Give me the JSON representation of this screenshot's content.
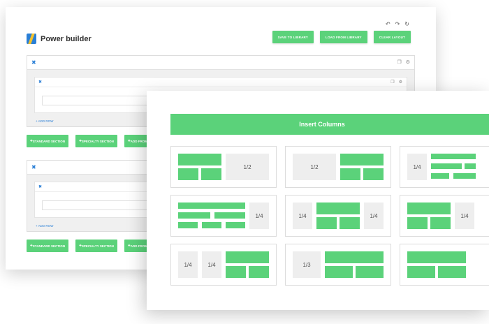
{
  "builder": {
    "brand": "Power builder",
    "undo_icons": [
      "undo-icon",
      "redo-icon",
      "reset-icon"
    ],
    "top_buttons": [
      "SAVE TO LIBRARY",
      "LOAD FROM LIBRARY",
      "CLEAR LAYOUT"
    ],
    "sections": [
      {
        "add_row": "ADD ROW",
        "buttons": [
          "STANDARD SECTION",
          "SPECIALTY SECTION",
          "ADD FROM LI"
        ]
      },
      {
        "add_row": "ADD ROW",
        "buttons": [
          "STANDARD SECTION",
          "SPECIALTY SECTION",
          "ADD FROM LI"
        ]
      }
    ]
  },
  "modal": {
    "title": "Insert Columns",
    "labels": {
      "half": "1/2",
      "quarter": "1/4",
      "third": "1/3"
    }
  },
  "colors": {
    "accent": "#5bd27a",
    "link": "#2a7fd6"
  }
}
